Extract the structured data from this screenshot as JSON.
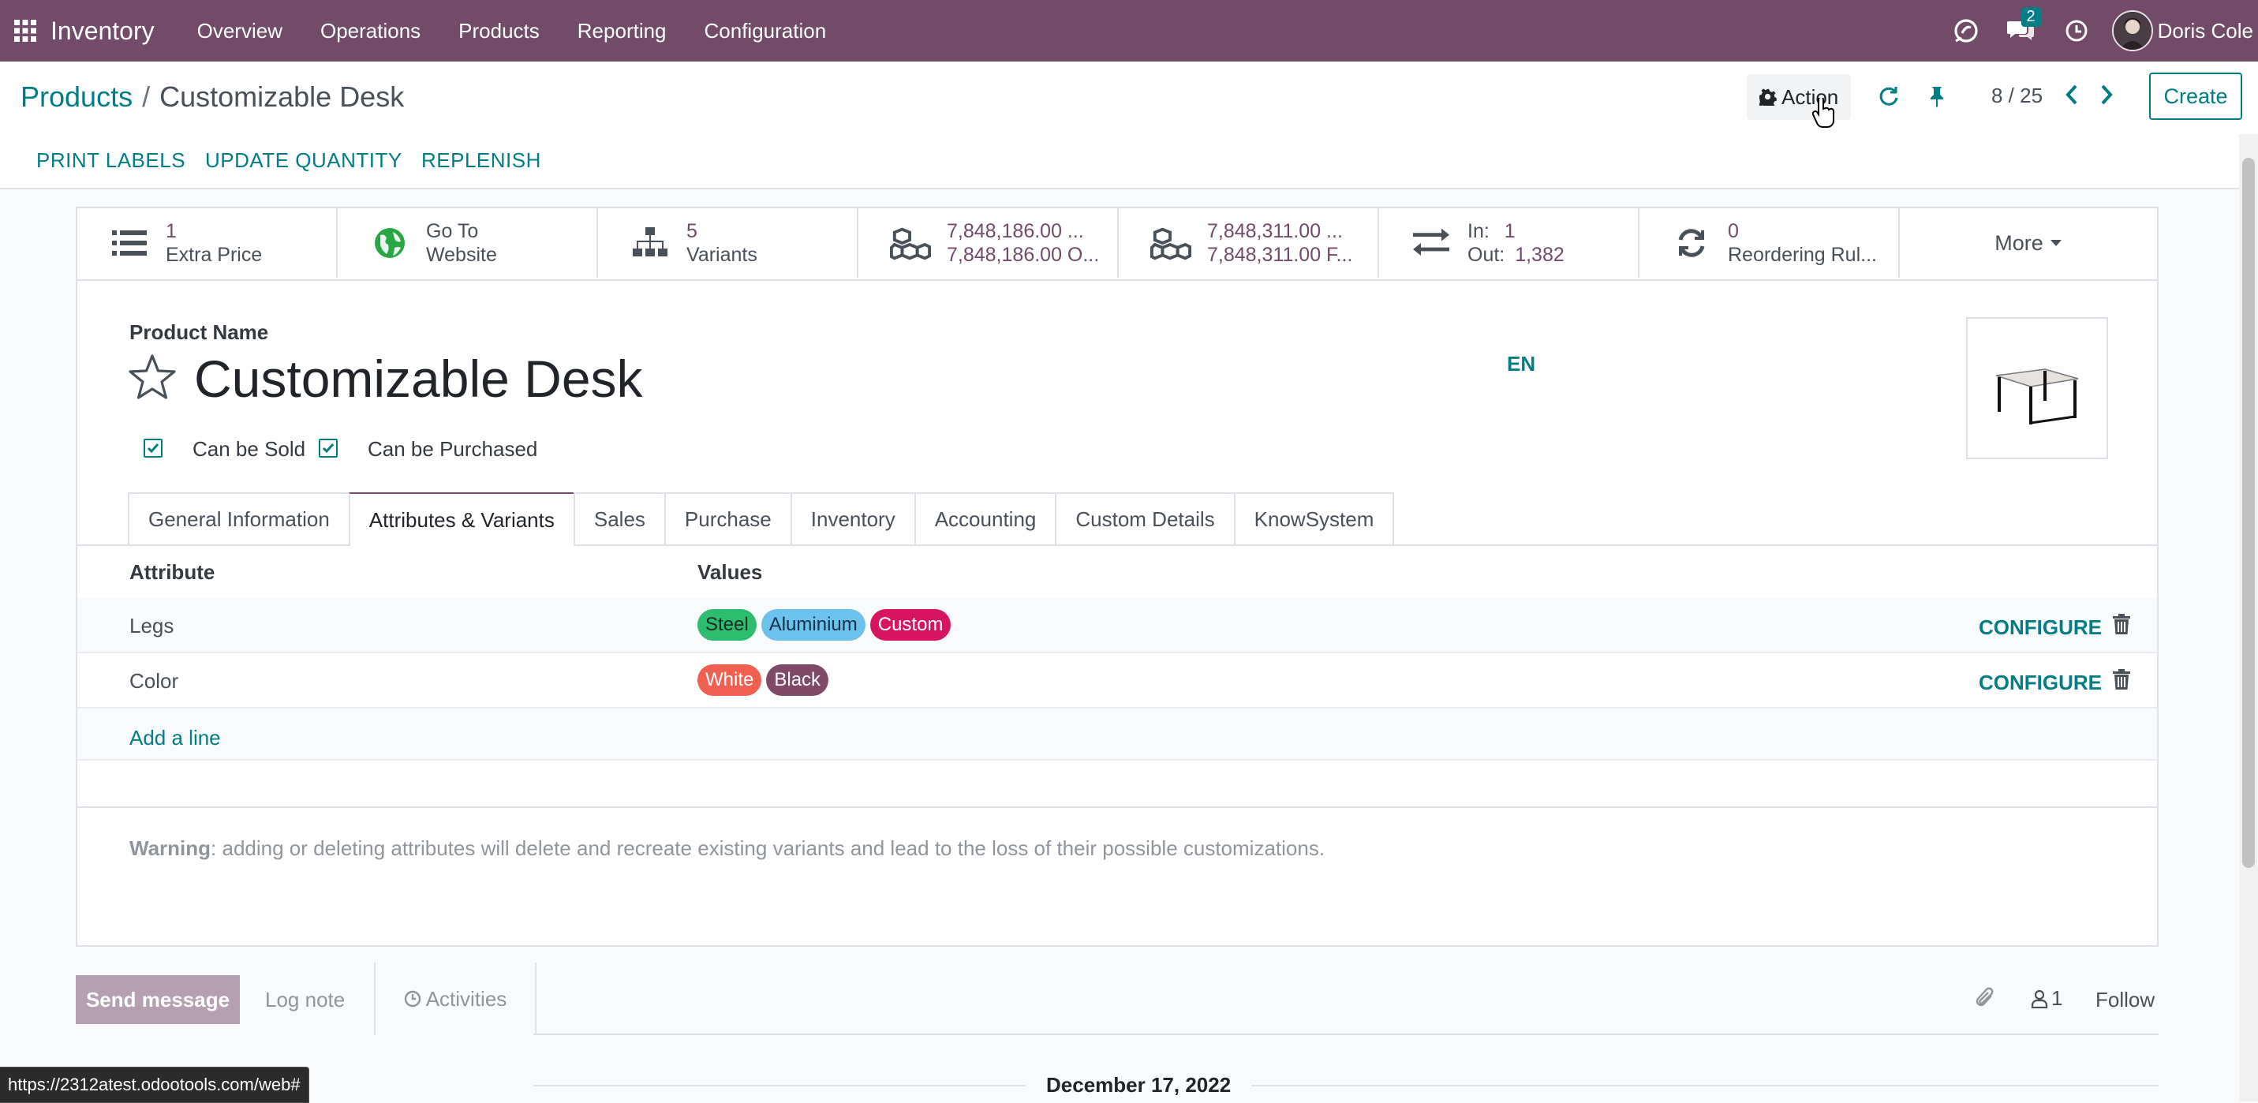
{
  "topbar": {
    "brand": "Inventory",
    "menu": [
      "Overview",
      "Operations",
      "Products",
      "Reporting",
      "Configuration"
    ],
    "messages_badge": "2",
    "user_name": "Doris Cole"
  },
  "control": {
    "breadcrumb_parent": "Products",
    "breadcrumb_separator": "/",
    "breadcrumb_current": "Customizable Desk",
    "action_label": "Action",
    "pager": "8 / 25",
    "create_label": "Create"
  },
  "statusbar": {
    "buttons": [
      "PRINT LABELS",
      "UPDATE QUANTITY",
      "REPLENISH"
    ]
  },
  "smart_buttons": [
    {
      "line1": "1",
      "line2": "Extra Price",
      "icon": "list-icon"
    },
    {
      "line1": "Go To",
      "line2": "Website",
      "icon": "globe-icon"
    },
    {
      "line1": "5",
      "line2": "Variants",
      "icon": "sitemap-icon"
    },
    {
      "line1": "7,848,186.00 ...",
      "line2": "7,848,186.00 O...",
      "icon": "cubes-icon"
    },
    {
      "line1": "7,848,311.00 ...",
      "line2": "7,848,311.00 F...",
      "icon": "cubes-icon"
    },
    {
      "in_label": "In:",
      "in_value": "1",
      "out_label": "Out:",
      "out_value": "1,382",
      "icon": "exchange-icon"
    },
    {
      "line1": "0",
      "line2": "Reordering Rul...",
      "icon": "refresh-icon"
    }
  ],
  "more_label": "More",
  "form": {
    "field_label": "Product Name",
    "product_name": "Customizable Desk",
    "lang": "EN",
    "can_be_sold": "Can be Sold",
    "can_be_purchased": "Can be Purchased"
  },
  "tabs": [
    "General Information",
    "Attributes & Variants",
    "Sales",
    "Purchase",
    "Inventory",
    "Accounting",
    "Custom Details",
    "KnowSystem"
  ],
  "active_tab": "Attributes & Variants",
  "attributes": {
    "col_attribute": "Attribute",
    "col_values": "Values",
    "rows": [
      {
        "name": "Legs",
        "values": [
          {
            "label": "Steel",
            "color": "#2dbd6e"
          },
          {
            "label": "Aluminium",
            "color": "#6cc1ed"
          },
          {
            "label": "Custom",
            "color": "#d6145f"
          }
        ]
      },
      {
        "name": "Color",
        "values": [
          {
            "label": "White",
            "color": "#f06050"
          },
          {
            "label": "Black",
            "color": "#814968"
          }
        ]
      }
    ],
    "configure_label": "CONFIGURE",
    "add_line": "Add a line"
  },
  "warning": {
    "title": "Warning",
    "text": ": adding or deleting attributes will delete and recreate existing variants and lead to the loss of their possible customizations."
  },
  "chatter": {
    "send_message": "Send message",
    "log_note": "Log note",
    "activities": "Activities",
    "followers_count": "1",
    "follow": "Follow",
    "date": "December 17, 2022"
  },
  "status_url": "https://2312atest.odootools.com/web#",
  "colors": {
    "brand": "#714b67",
    "accent": "#017e84"
  }
}
